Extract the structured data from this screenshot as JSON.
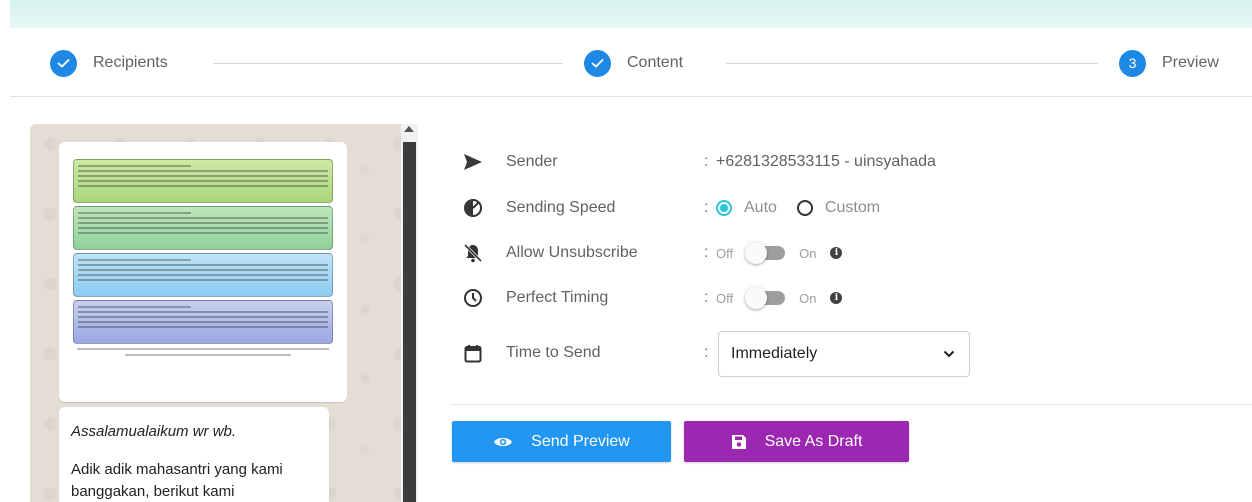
{
  "stepper": {
    "steps": [
      {
        "label": "Recipients",
        "state": "done",
        "icon": "check-icon"
      },
      {
        "label": "Content",
        "state": "done",
        "icon": "check-icon"
      },
      {
        "label": "Preview",
        "state": "active",
        "number": "3"
      }
    ]
  },
  "preview": {
    "image_icon": "poster-image",
    "message_lines": [
      "Assalamualaikum wr wb.",
      "Adik adik mahasantri yang kami",
      "banggakan, berikut kami"
    ]
  },
  "settings": {
    "sender": {
      "label": "Sender",
      "value": "+6281328533115 - uinsyahada",
      "icon": "send-icon"
    },
    "speed": {
      "label": "Sending Speed",
      "options": [
        "Auto",
        "Custom"
      ],
      "selected": "Auto",
      "icon": "speed-icon"
    },
    "unsubscribe": {
      "label": "Allow Unsubscribe",
      "off": "Off",
      "on": "On",
      "state": "Off",
      "icon": "bell-off-icon"
    },
    "timing": {
      "label": "Perfect Timing",
      "off": "Off",
      "on": "On",
      "state": "Off",
      "icon": "clock-icon"
    },
    "time_to_send": {
      "label": "Time to Send",
      "value": "Immediately",
      "icon": "calendar-icon"
    }
  },
  "actions": {
    "send_preview": "Send Preview",
    "save_draft": "Save As Draft"
  },
  "colors": {
    "primary": "#1e88e5",
    "radio": "#26c6da",
    "preview_button": "#2196f3",
    "draft_button": "#9c27b0"
  }
}
